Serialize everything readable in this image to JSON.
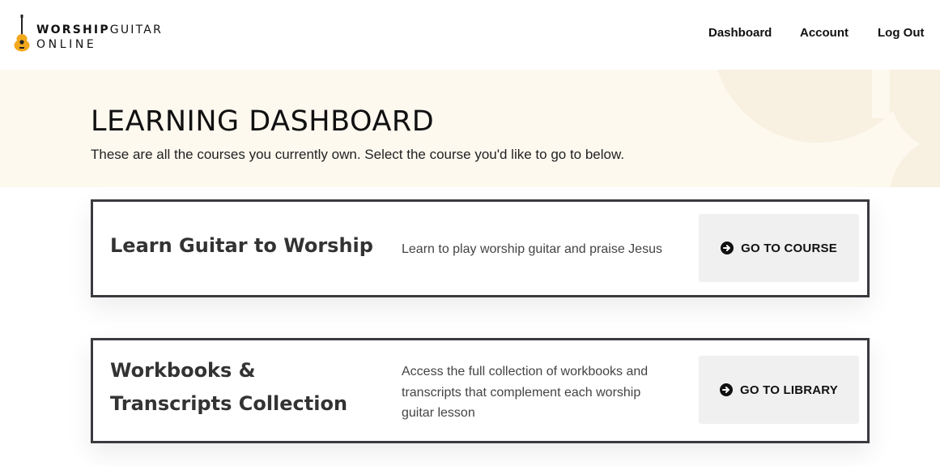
{
  "brand": {
    "line1_bold": "WORSHIP",
    "line1_light": "GUITAR",
    "line2": "ONLINE",
    "logo_icon": "guitar-icon",
    "accent_color": "#f2a81d"
  },
  "nav": {
    "items": [
      {
        "label": "Dashboard"
      },
      {
        "label": "Account"
      },
      {
        "label": "Log Out"
      }
    ]
  },
  "hero": {
    "title": "LEARNING DASHBOARD",
    "subtitle": "These are all the courses you currently own. Select the course you'd like to go to below.",
    "background_color": "#fdf9ef"
  },
  "courses": [
    {
      "title": "Learn Guitar to Worship",
      "description": "Learn to play worship guitar and praise Jesus",
      "button_label": "GO TO COURSE",
      "button_icon": "arrow-circle-right-icon"
    },
    {
      "title": "Workbooks & Transcripts Collection",
      "description": "Access the full collection of workbooks and transcripts that complement each worship guitar lesson",
      "button_label": "GO TO LIBRARY",
      "button_icon": "arrow-circle-right-icon"
    }
  ]
}
